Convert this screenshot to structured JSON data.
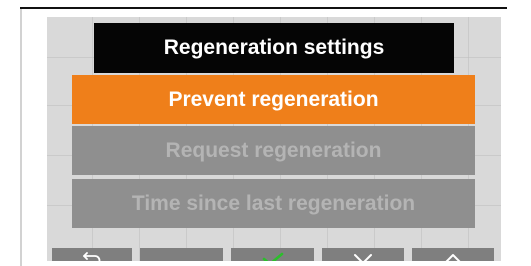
{
  "header": {
    "title": "Regeneration settings"
  },
  "menu": {
    "items": [
      {
        "label": "Prevent regeneration",
        "state": "selected"
      },
      {
        "label": "Request regeneration",
        "state": "disabled"
      },
      {
        "label": "Time since last regeneration",
        "state": "disabled"
      }
    ]
  },
  "softkeys": [
    {
      "icon": "back-arrow-icon"
    },
    {
      "icon": ""
    },
    {
      "icon": "checkmark-icon"
    },
    {
      "icon": "chevron-down-icon"
    },
    {
      "icon": "chevron-up-icon"
    }
  ],
  "colors": {
    "accent": "#ef7f1a",
    "title_background": "#050505",
    "disabled_item": "#8f8f8f",
    "disabled_text": "#b4b4b4",
    "softkey_background": "#7f7f7f",
    "confirm_icon": "#2bbf2b",
    "screen_background": "#d9d9d9"
  }
}
